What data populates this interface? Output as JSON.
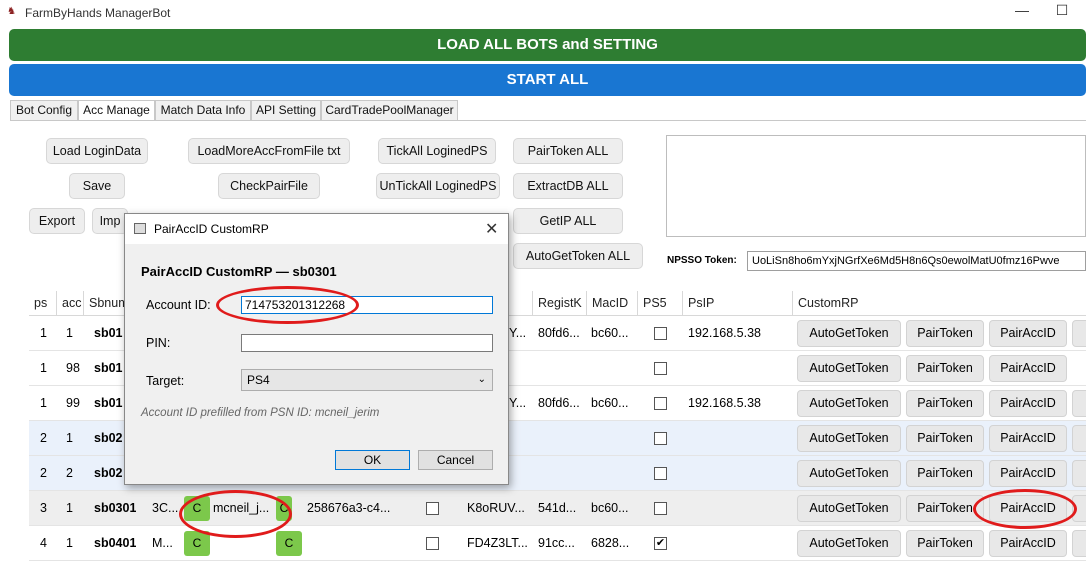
{
  "window": {
    "title": "FarmByHands ManagerBot",
    "min_glyph": "—",
    "max_glyph": "☐"
  },
  "top_buttons": {
    "load_all": "LOAD ALL BOTS and SETTING",
    "start_all": "START ALL"
  },
  "tabs": [
    "Bot Config",
    "Acc Manage",
    "Match Data Info",
    "API Setting",
    "CardTradePoolManager"
  ],
  "active_tab": "Acc Manage",
  "toolbar": {
    "load_logindata": "Load LoginData",
    "save": "Save",
    "export": "Export",
    "import": "Imp",
    "load_more": "LoadMoreAccFromFile txt",
    "check_pair": "CheckPairFile",
    "tick_all": "TickAll LoginedPS",
    "untick_all": "UnTickAll LoginedPS",
    "pair_token_all": "PairToken ALL",
    "extract_db_all": "ExtractDB ALL",
    "getip_all": "GetIP ALL",
    "autogettoken_all": "AutoGetToken ALL"
  },
  "npsso": {
    "label": "NPSSO Token:",
    "value": "UoLiSn8ho6mYxjNGrfXe6Md5H8n6Qs0ewolMatU0fmz16Pwve"
  },
  "grid": {
    "headers": {
      "ps": "ps",
      "acc": "acc",
      "sbnum": "Sbnum",
      "registk": "RegistK",
      "macid": "MacID",
      "ps5": "PS5",
      "psip": "PsIP",
      "customrp": "CustomRP"
    },
    "rows": [
      {
        "ps": "1",
        "acc": "1",
        "sb": "sb01",
        "k8": "Y...",
        "reg": "80fd6...",
        "mac": "bc60...",
        "ps5": false,
        "ip": "192.168.5.38"
      },
      {
        "ps": "1",
        "acc": "98",
        "sb": "sb01",
        "k8": "",
        "reg": "",
        "mac": "",
        "ps5": false,
        "ip": ""
      },
      {
        "ps": "1",
        "acc": "99",
        "sb": "sb01",
        "k8": "Y...",
        "reg": "80fd6...",
        "mac": "bc60...",
        "ps5": false,
        "ip": "192.168.5.38"
      },
      {
        "ps": "2",
        "acc": "1",
        "sb": "sb02",
        "k8": "",
        "reg": "",
        "mac": "",
        "ps5": false,
        "ip": ""
      },
      {
        "ps": "2",
        "acc": "2",
        "sb": "sb02",
        "k8": "",
        "reg": "",
        "mac": "",
        "ps5": false,
        "ip": ""
      },
      {
        "ps": "3",
        "acc": "1",
        "sb": "sb0301",
        "k8": "K8oRUV...",
        "reg": "541d...",
        "mac": "bc60...",
        "ps5": false,
        "ip": "",
        "extra": "3C...",
        "name": "mcneil_j...",
        "uuid": "258676a3-c4..."
      },
      {
        "ps": "4",
        "acc": "1",
        "sb": "sb0401",
        "k8": "FD4Z3LT...",
        "reg": "91cc...",
        "mac": "6828...",
        "ps5": true,
        "ip": "",
        "extra": "M..."
      }
    ],
    "row_buttons": {
      "autogettoken": "AutoGetToken",
      "pairtoken": "PairToken",
      "pairaccid": "PairAccID"
    },
    "green_letter": "C"
  },
  "dialog": {
    "title": "PairAccID CustomRP",
    "heading": "PairAccID CustomRP — sb0301",
    "account_id_label": "Account ID:",
    "account_id_value": "714753201312268",
    "pin_label": "PIN:",
    "pin_value": "",
    "target_label": "Target:",
    "target_value": "PS4",
    "note": "Account ID prefilled from PSN ID: mcneil_jerim",
    "ok": "OK",
    "cancel": "Cancel",
    "close_glyph": "✕"
  },
  "colors": {
    "load_btn": "#2e7d32",
    "start_btn": "#1976d2",
    "highlight": "#e01b1b",
    "green_box": "#7cc84b"
  }
}
